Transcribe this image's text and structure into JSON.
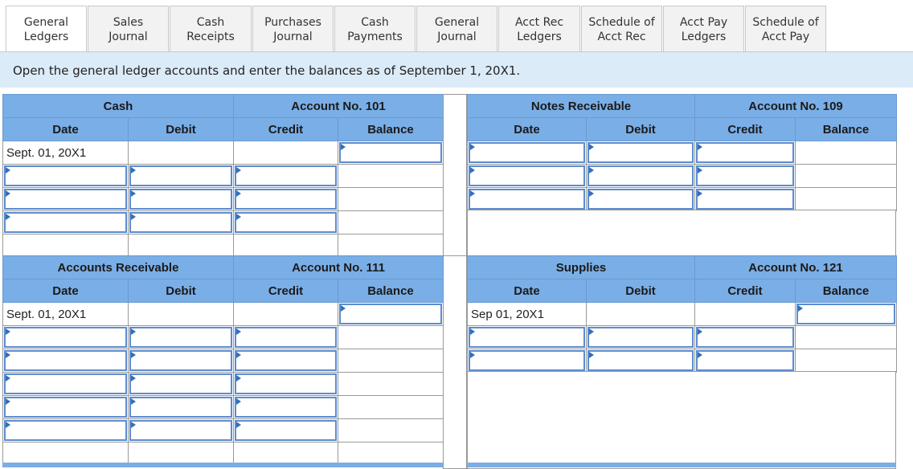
{
  "tabs": [
    {
      "label": "General\nLedgers",
      "active": true
    },
    {
      "label": "Sales\nJournal"
    },
    {
      "label": "Cash\nReceipts"
    },
    {
      "label": "Purchases\nJournal"
    },
    {
      "label": "Cash\nPayments"
    },
    {
      "label": "General\nJournal"
    },
    {
      "label": "Acct Rec\nLedgers"
    },
    {
      "label": "Schedule of\nAcct Rec"
    },
    {
      "label": "Acct Pay\nLedgers"
    },
    {
      "label": "Schedule of\nAcct Pay"
    }
  ],
  "instruction": "Open the general ledger accounts and enter the balances as of September 1, 20X1.",
  "accounts": {
    "cash": {
      "name": "Cash",
      "number": "Account No. 101",
      "opening_date": "Sept. 01, 20X1"
    },
    "notes": {
      "name": "Notes Receivable",
      "number": "Account No. 109"
    },
    "ar": {
      "name": "Accounts Receivable",
      "number": "Account No. 111",
      "opening_date": "Sept. 01, 20X1"
    },
    "supplies": {
      "name": "Supplies",
      "number": "Account No. 121",
      "opening_date": "Sep 01, 20X1"
    }
  },
  "columns": {
    "date": "Date",
    "debit": "Debit",
    "credit": "Credit",
    "balance": "Balance"
  }
}
